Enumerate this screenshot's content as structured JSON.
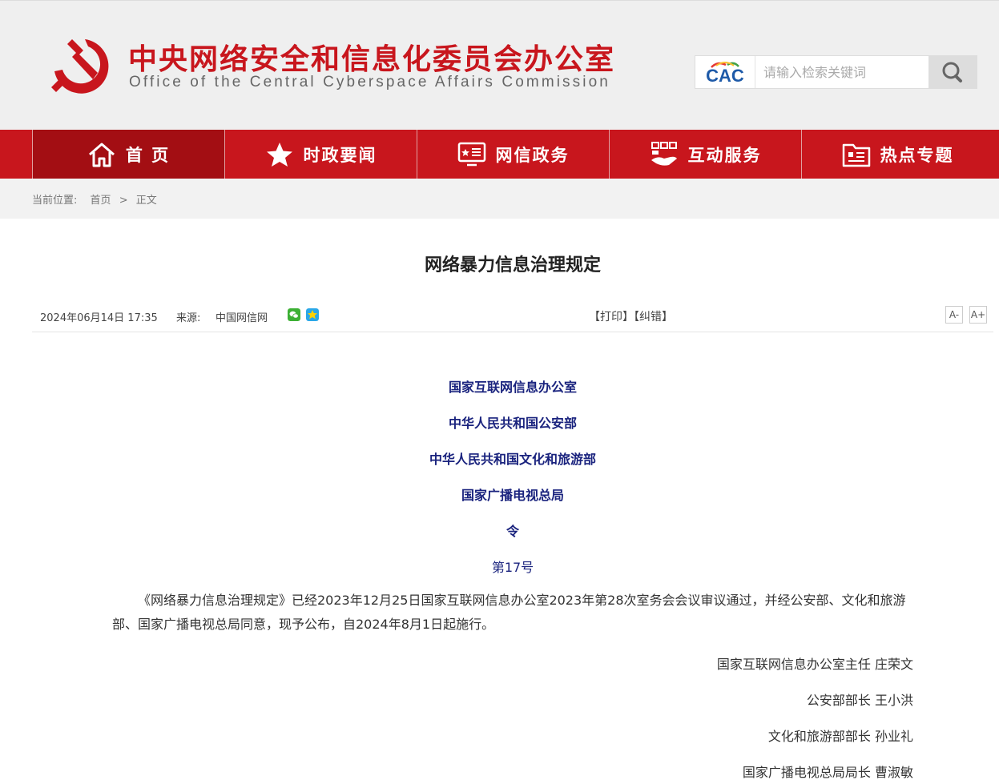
{
  "header": {
    "title_cn": "中央网络安全和信息化委员会办公室",
    "title_en": "Office of the Central Cyberspace Affairs Commission",
    "logo_text": "CAC",
    "search_placeholder": "请输入检索关键词"
  },
  "nav": {
    "items": [
      {
        "label": "首 页",
        "icon": "home-icon"
      },
      {
        "label": "时政要闻",
        "icon": "star-icon"
      },
      {
        "label": "网信政务",
        "icon": "monitor-icon"
      },
      {
        "label": "互动服务",
        "icon": "hand-icon"
      },
      {
        "label": "热点专题",
        "icon": "folder-icon"
      }
    ]
  },
  "breadcrumb": {
    "prefix": "当前位置:",
    "home": "首页",
    "sep": ">",
    "current": "正文"
  },
  "article": {
    "title": "网络暴力信息治理规定",
    "date": "2024年06月14日 17:35",
    "source_label": "来源:",
    "source": "中国网信网",
    "print": "【打印】",
    "correct": "【纠错】",
    "font_smaller": "A-",
    "font_larger": "A+",
    "issuers": [
      "国家互联网信息办公室",
      "中华人民共和国公安部",
      "中华人民共和国文化和旅游部",
      "国家广播电视总局",
      "令",
      "第17号"
    ],
    "paragraph": "《网络暴力信息治理规定》已经2023年12月25日国家互联网信息办公室2023年第28次室务会会议审议通过，并经公安部、文化和旅游部、国家广播电视总局同意，现予公布，自2024年8月1日起施行。",
    "signatures": [
      "国家互联网信息办公室主任 庄荣文",
      "公安部部长 王小洪",
      "文化和旅游部部长 孙业礼",
      "国家广播电视总局局长 曹淑敏"
    ]
  },
  "colors": {
    "brand_red": "#c8161d",
    "nav_active": "#a30e13",
    "issuer_blue": "#1a237e"
  }
}
